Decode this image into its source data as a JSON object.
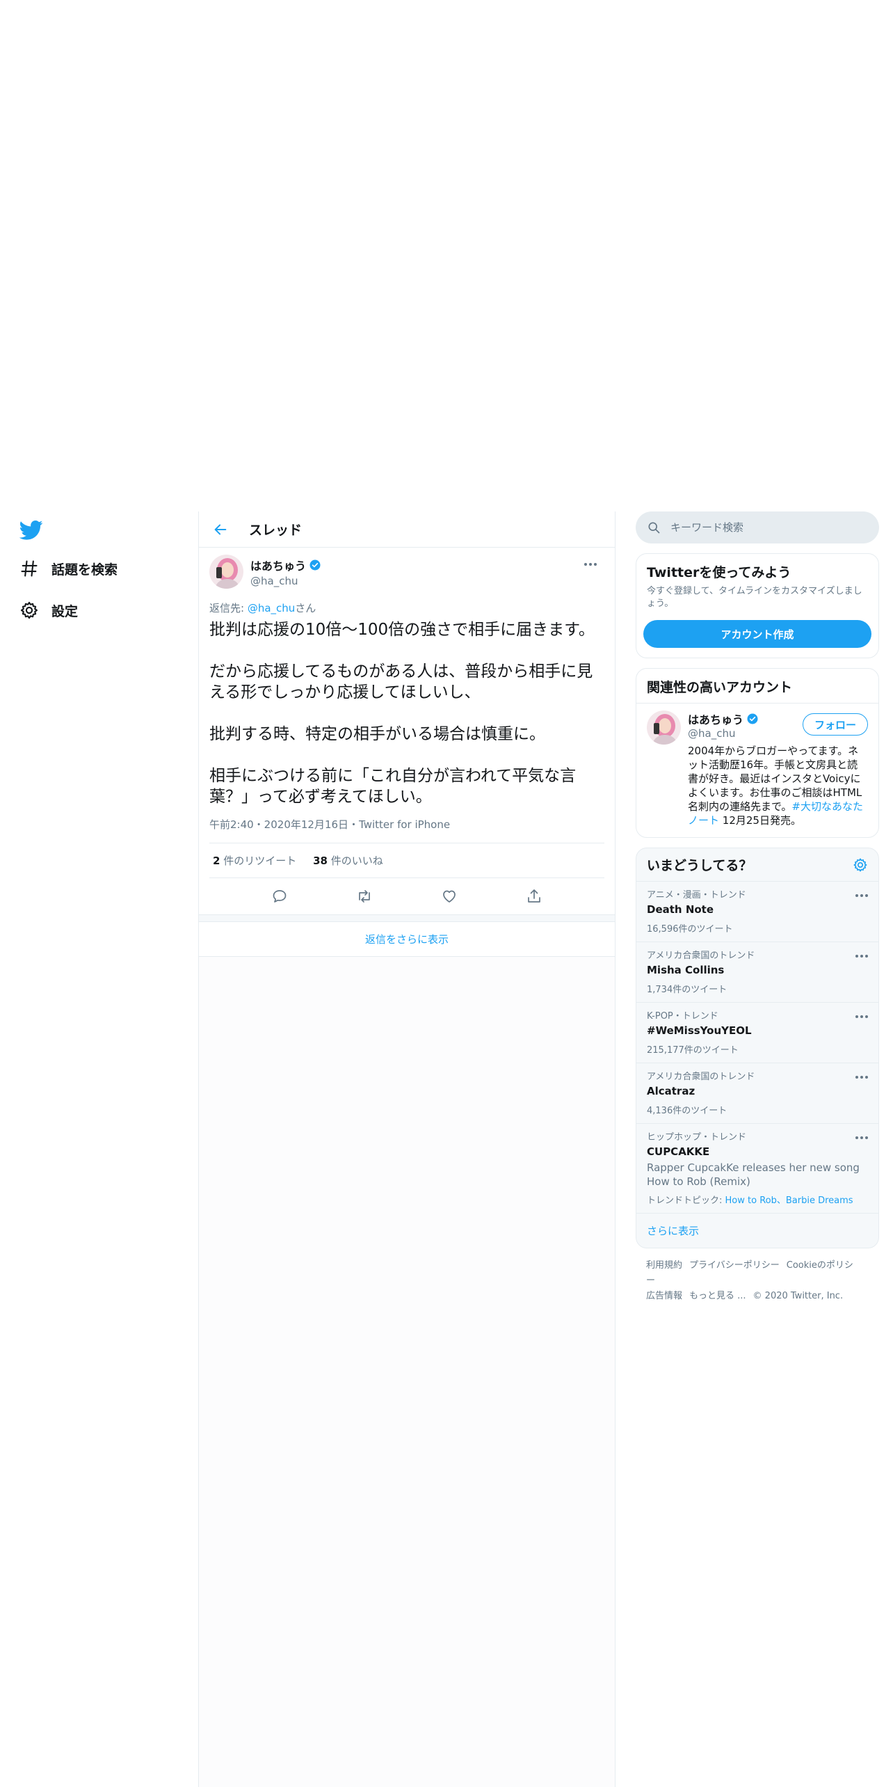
{
  "nav": {
    "items": [
      {
        "label": "話題を検索",
        "icon": "hashtag-icon"
      },
      {
        "label": "設定",
        "icon": "gear-icon"
      }
    ]
  },
  "thread": {
    "title": "スレッド",
    "tweet": {
      "name": "はあちゅう",
      "handle": "@ha_chu",
      "reply_prefix": "返信先: ",
      "reply_handle": "@ha_chu",
      "reply_suffix": "さん",
      "paragraphs": [
        "批判は応援の10倍〜100倍の強さで相手に届きます。",
        "だから応援してるものがある人は、普段から相手に見える形でしっかり応援してほしいし、",
        "批判する時、特定の相手がいる場合は慎重に。",
        "相手にぶつける前に「これ自分が言われて平気な言葉？」って必ず考えてほしい。"
      ],
      "meta": "午前2:40・2020年12月16日・Twitter for iPhone",
      "retweet_count": "2",
      "retweet_label": " 件のリツイート",
      "like_count": "38",
      "like_label": " 件のいいね"
    },
    "more_replies": "返信をさらに表示"
  },
  "sidebar": {
    "search_placeholder": "キーワード検索",
    "signup": {
      "title": "Twitterを使ってみよう",
      "subtitle": "今すぐ登録して、タイムラインをカスタマイズしましょう。",
      "button": "アカウント作成"
    },
    "related": {
      "title": "関連性の高いアカウント",
      "name": "はあちゅう",
      "handle": "@ha_chu",
      "follow": "フォロー",
      "bio_text": "2004年からブロガーやってます。ネット活動歴16年。手帳と文房具と読書が好き。最近はインスタとVoicyによくいます。お仕事のご相談はHTML名刺内の連絡先まで。",
      "bio_link": "#大切なあなたノート",
      "bio_tail": " 12月25日発売。"
    },
    "trends": {
      "title": "いまどうしてる？",
      "items": [
        {
          "context": "アニメ・漫画・トレンド",
          "name": "Death Note",
          "count": "16,596件のツイート"
        },
        {
          "context": "アメリカ合衆国のトレンド",
          "name": "Misha Collins",
          "count": "1,734件のツイート"
        },
        {
          "context": "K-POP・トレンド",
          "name": "#WeMissYouYEOL",
          "count": "215,177件のツイート"
        },
        {
          "context": "アメリカ合衆国のトレンド",
          "name": "Alcatraz",
          "count": "4,136件のツイート"
        }
      ],
      "last": {
        "context": "ヒップホップ・トレンド",
        "name": "CUPCAKKE",
        "desc": "Rapper CupcakKe releases her new song How to Rob (Remix)",
        "topics_label": "トレンドトピック: ",
        "topics": "How to Rob、Barbie Dreams"
      },
      "show_more": "さらに表示"
    },
    "footer": {
      "terms": "利用規約",
      "privacy": "プライバシーポリシー",
      "cookie": "Cookieのポリシー",
      "ads": "広告情報",
      "more": "もっと見る ...",
      "copyright": "© 2020 Twitter, Inc."
    }
  },
  "colors": {
    "accent": "#1da1f2",
    "text": "#14171a",
    "muted": "#657786",
    "border": "#e6ecf0"
  }
}
